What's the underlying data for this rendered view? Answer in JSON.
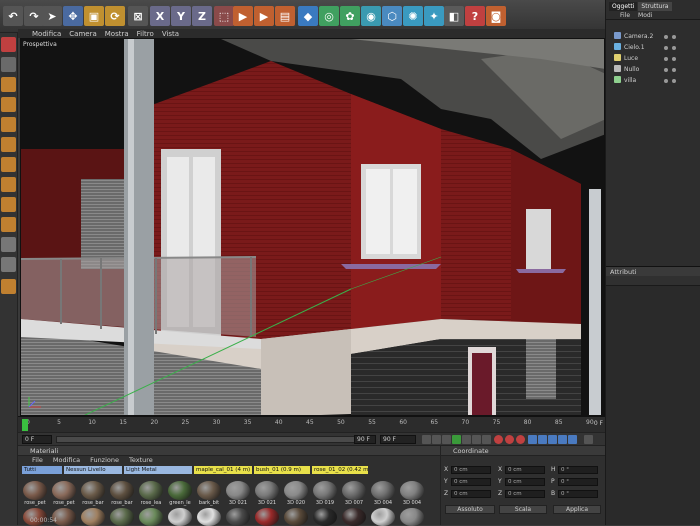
{
  "toolbar": {
    "icons": [
      "undo-icon",
      "redo-icon",
      "select-icon",
      "move-icon",
      "scale-icon",
      "rotate-icon",
      "x-axis-icon",
      "y-axis-icon",
      "z-axis-icon",
      "coord-icon",
      "render-region-icon",
      "render-view-icon",
      "render-settings-icon",
      "cube-icon",
      "nurbs-icon",
      "spline-icon",
      "generator-icon",
      "deformer-icon",
      "particle-icon",
      "camera-icon",
      "light-icon",
      "material-icon"
    ],
    "axes": [
      "X",
      "Y",
      "Z"
    ]
  },
  "viewport": {
    "menu": [
      "Modifica",
      "Camera",
      "Mostra",
      "Filtro",
      "Vista"
    ],
    "label": "Prospettiva"
  },
  "timeline": {
    "ticks": [
      "0",
      "5",
      "10",
      "15",
      "20",
      "25",
      "30",
      "35",
      "40",
      "45",
      "50",
      "55",
      "60",
      "65",
      "70",
      "75",
      "80",
      "85",
      "90"
    ],
    "end_marker": "0 F"
  },
  "transport": {
    "start": "0 F",
    "end": "90 F",
    "end2": "90 F"
  },
  "materials": {
    "title": "Materiali",
    "menu": [
      "File",
      "Modifica",
      "Funzione",
      "Texture"
    ],
    "filters": [
      "Tutti",
      "Nessun Livello",
      "Light Metal",
      "maple_cal_01 (4 m)",
      "bush_01 (0.9 m)",
      "rose_01_02 (0.42 m)"
    ],
    "swatches": [
      {
        "label": "rose_pet",
        "color": "#7a5a4a"
      },
      {
        "label": "rose_pet",
        "color": "#8a6a5a"
      },
      {
        "label": "rose_bar",
        "color": "#6a5a48"
      },
      {
        "label": "rose_bar",
        "color": "#5e5040"
      },
      {
        "label": "rose_lea",
        "color": "#5a6a4a"
      },
      {
        "label": "green_le",
        "color": "#4a6a3a"
      },
      {
        "label": "bark_bit",
        "color": "#6a5a4a"
      },
      {
        "label": "3D 021",
        "color": "#888"
      },
      {
        "label": "3D 021",
        "color": "#7a7a7a"
      },
      {
        "label": "3D 020",
        "color": "#8a8a8a"
      },
      {
        "label": "3D 019",
        "color": "#777"
      },
      {
        "label": "3D 007",
        "color": "#6a6a6a"
      },
      {
        "label": "3D 004",
        "color": "#707070"
      },
      {
        "label": "3D 004",
        "color": "#808080"
      }
    ],
    "swatches_row2_colors": [
      "#8a4a3a",
      "#7a5a4a",
      "#a08060",
      "#5a6a4a",
      "#6a8a5a",
      "#cfcfcf",
      "#e0e0e0",
      "#4a4a4a",
      "#9a2a2a",
      "#5a4a3a",
      "#2a2a2a",
      "#3a2a2a",
      "#d0d0d0",
      "#888"
    ],
    "status": "00:00:54"
  },
  "coordinates": {
    "title": "Coordinate",
    "rows": [
      {
        "a": "X",
        "av": "0 cm",
        "b": "X",
        "bv": "0 cm",
        "c": "H",
        "cv": "0 °"
      },
      {
        "a": "Y",
        "av": "0 cm",
        "b": "Y",
        "bv": "0 cm",
        "c": "P",
        "cv": "0 °"
      },
      {
        "a": "Z",
        "av": "0 cm",
        "b": "Z",
        "bv": "0 cm",
        "c": "B",
        "cv": "0 °"
      }
    ],
    "mode1": "Assoluto",
    "mode2": "Scala",
    "apply": "Applica"
  },
  "objects_panel": {
    "tabs": [
      "Oggetti",
      "Struttura"
    ],
    "menu": [
      "File",
      "Modi"
    ],
    "items": [
      {
        "label": "Camera.2",
        "icon_color": "#7a9acc"
      },
      {
        "label": "Cielo.1",
        "icon_color": "#6ab0e0"
      },
      {
        "label": "Luce",
        "icon_color": "#e0d070"
      },
      {
        "label": "Nullo",
        "icon_color": "#bbbbbb"
      },
      {
        "label": "villa",
        "icon_color": "#8fd08f"
      }
    ]
  },
  "attributes_panel": {
    "title": "Attributi"
  },
  "colors": {
    "wall_red": "#7a1a1a",
    "accent_highlight": "#e8e04a"
  }
}
